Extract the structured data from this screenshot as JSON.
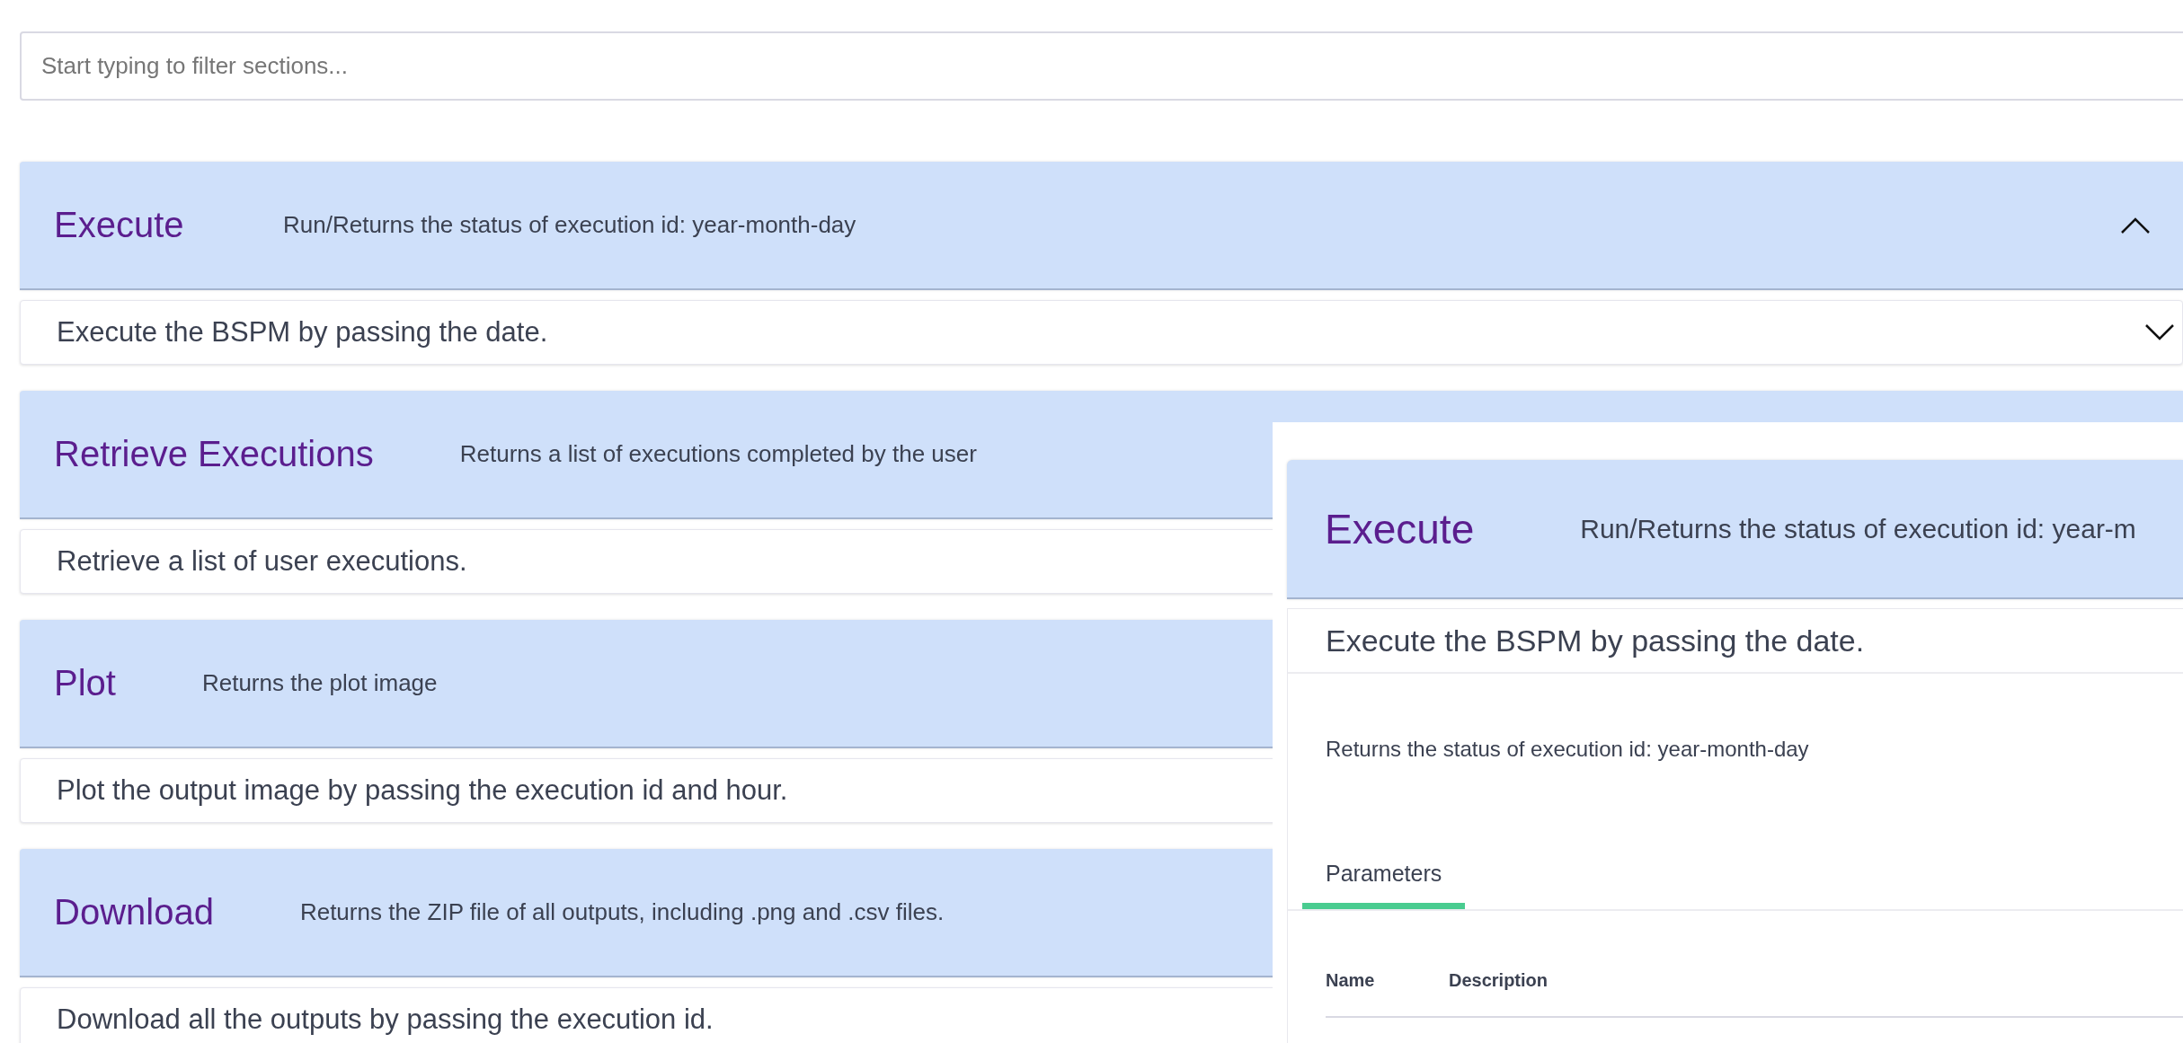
{
  "search": {
    "placeholder": "Start typing to filter sections..."
  },
  "sections": [
    {
      "title": "Execute",
      "summary": "Run/Returns the status of execution id: year-month-day",
      "description": "Execute the BSPM by passing the date."
    },
    {
      "title": "Retrieve Executions",
      "summary": "Returns a list of executions completed by the user",
      "description": "Retrieve a list of user executions."
    },
    {
      "title": "Plot",
      "summary": "Returns the plot image",
      "description": "Plot the output image by passing the execution id and hour."
    },
    {
      "title": "Download",
      "summary": "Returns the ZIP file of all outputs, including .png and .csv files.",
      "description": "Download all the outputs by passing the execution id."
    }
  ],
  "detail": {
    "title": "Execute",
    "summary": "Run/Returns the status of execution id: year-m",
    "description": "Execute the BSPM by passing the date.",
    "note": "Returns the status of execution id: year-month-day",
    "tabs": [
      {
        "label": "Parameters",
        "selected": true
      }
    ],
    "columns": [
      "Name",
      "Description"
    ]
  }
}
